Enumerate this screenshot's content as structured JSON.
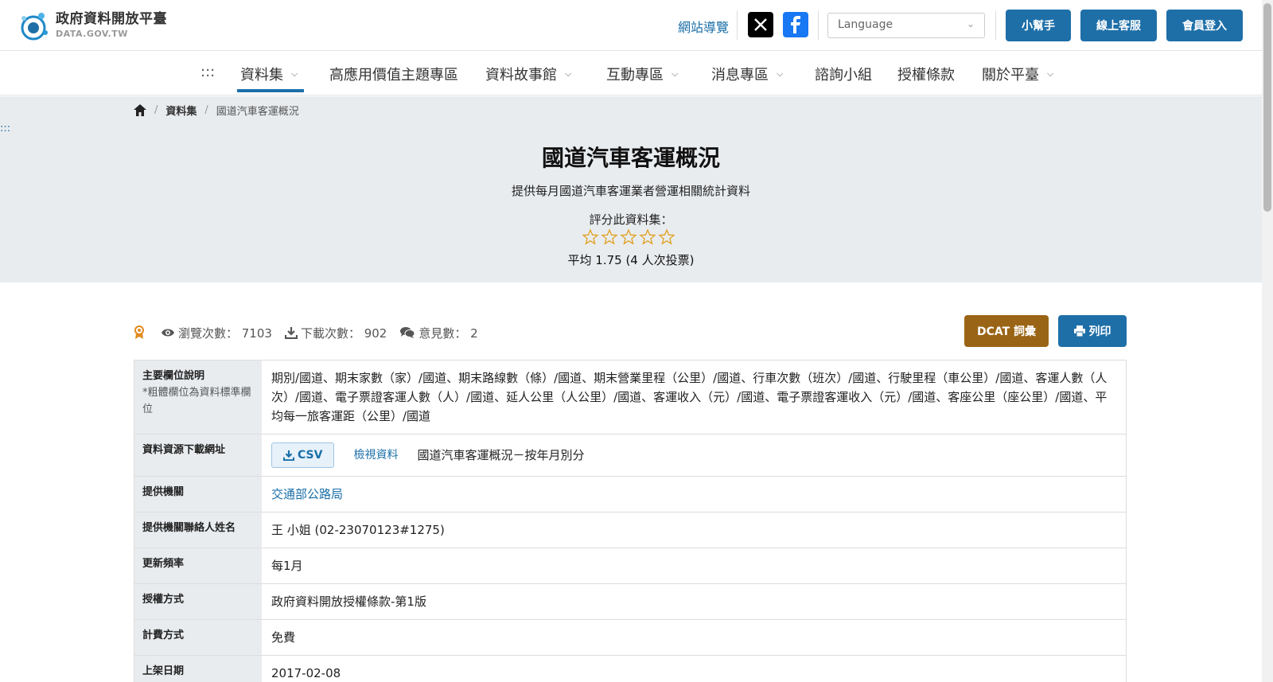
{
  "header": {
    "logo_title": "政府資料開放平臺",
    "logo_sub": "DATA.GOV.TW",
    "sitemap": "網站導覽",
    "language_placeholder": "Language",
    "helper_btn": "小幫手",
    "support_btn": "線上客服",
    "login_btn": "會員登入",
    "brand_color": "#1e6fa8"
  },
  "nav": {
    "skip": ":::",
    "items": [
      {
        "label": "資料集",
        "has_dropdown": true
      },
      {
        "label": "高應用價值主題專區",
        "has_dropdown": false
      },
      {
        "label": "資料故事館",
        "has_dropdown": true
      },
      {
        "label": "互動專區",
        "has_dropdown": true
      },
      {
        "label": "消息專區",
        "has_dropdown": true
      },
      {
        "label": "諮詢小組",
        "has_dropdown": false
      },
      {
        "label": "授權條款",
        "has_dropdown": false
      },
      {
        "label": "關於平臺",
        "has_dropdown": true
      }
    ]
  },
  "breadcrumb": {
    "section": "資料集",
    "current": "國道汽車客運概況"
  },
  "hero": {
    "skip": ":::",
    "title": "國道汽車客運概況",
    "description": "提供每月國道汽車客運業者營運相關統計資料",
    "rate_label": "評分此資料集：",
    "rating_avg": "平均 1.75 (4 人次投票)",
    "stars_total": 5,
    "stars_filled": 0
  },
  "stats": {
    "views": "瀏覽次數： 7103",
    "downloads": "下載次數： 902",
    "comments": "意見數： 2",
    "dcat_btn": "DCAT 詞彙",
    "print_btn": "列印",
    "dcat_color": "#9a6416"
  },
  "table": {
    "fields_label": "主要欄位說明",
    "fields_note": "*粗體欄位為資料標準欄位",
    "fields_value": "期別/國道、期末家數（家）/國道、期末路線數（條）/國道、期末營業里程（公里）/國道、行車次數（班次）/國道、行駛里程（車公里）/國道、客運人數（人次）/國道、電子票證客運人數（人）/國道、延人公里（人公里）/國道、客運收入（元）/國道、電子票證客運收入（元）/國道、客座公里（座公里）/國道、平均每一旅客運距（公里）/國道",
    "download_label": "資料資源下載網址",
    "csv_btn": "CSV",
    "view_data": "檢視資料",
    "resource_name": "國道汽車客運概況－按年月別分",
    "provider_label": "提供機關",
    "provider_value": "交通部公路局",
    "contact_label": "提供機關聯絡人姓名",
    "contact_value": "王 小姐 (02-23070123#1275)",
    "freq_label": "更新頻率",
    "freq_value": "每1月",
    "license_label": "授權方式",
    "license_value": "政府資料開放授權條款-第1版",
    "fee_label": "計費方式",
    "fee_value": "免費",
    "date_label": "上架日期",
    "date_value": "2017-02-08"
  }
}
